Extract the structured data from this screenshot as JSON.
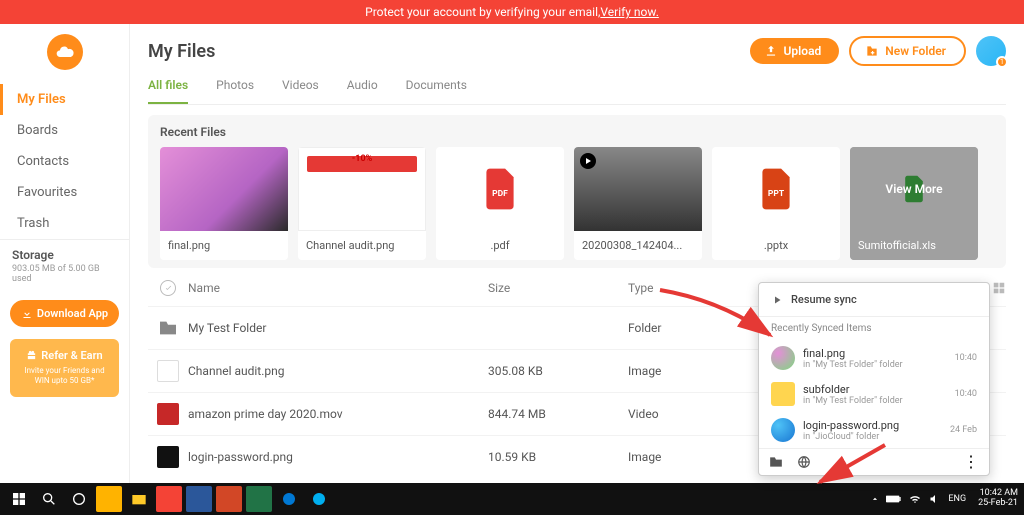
{
  "banner": {
    "text": "Protect your account by verifying your email, ",
    "link": "Verify now."
  },
  "header": {
    "title": "My Files",
    "upload": "Upload",
    "new_folder": "New Folder",
    "avatar_badge": "1"
  },
  "sidebar": {
    "items": [
      {
        "label": "My Files",
        "active": true
      },
      {
        "label": "Boards"
      },
      {
        "label": "Contacts"
      },
      {
        "label": "Favourites"
      },
      {
        "label": "Trash"
      }
    ],
    "storage_title": "Storage",
    "storage_used": "903.05 MB of 5.00 GB used",
    "download_label": "Download App",
    "refer_title": "Refer & Earn",
    "refer_sub": "Invite your Friends and WIN upto 50 GB*"
  },
  "tabs": [
    {
      "label": "All files",
      "active": true
    },
    {
      "label": "Photos"
    },
    {
      "label": "Videos"
    },
    {
      "label": "Audio"
    },
    {
      "label": "Documents"
    }
  ],
  "recent": {
    "title": "Recent Files",
    "items": [
      {
        "name": "final.png"
      },
      {
        "name": "Channel audit.png",
        "badge": "-10%"
      },
      {
        "name": ".pdf",
        "icon": "PDF",
        "color": "#e53935"
      },
      {
        "name": "20200308_142404...",
        "video": true
      },
      {
        "name": ".pptx",
        "icon": "PPT",
        "color": "#d84315"
      },
      {
        "name": "Sumitofficial.xls",
        "more": true,
        "overlay": "View More",
        "color": "#2e7d32"
      }
    ]
  },
  "table": {
    "cols": {
      "name": "Name",
      "size": "Size",
      "type": "Type"
    },
    "rows": [
      {
        "icon": "folder",
        "name": "My Test Folder",
        "size": "",
        "type": "Folder"
      },
      {
        "icon": "doc",
        "name": "Channel audit.png",
        "size": "305.08 KB",
        "type": "Image"
      },
      {
        "icon": "red",
        "name": "amazon prime day 2020.mov",
        "size": "844.74 MB",
        "type": "Video"
      },
      {
        "icon": "black",
        "name": "login-password.png",
        "size": "10.59 KB",
        "type": "Image"
      }
    ]
  },
  "sync": {
    "resume": "Resume sync",
    "subtitle": "Recently Synced Items",
    "items": [
      {
        "name": "final.png",
        "loc": "in \"My Test Folder\" folder",
        "time": "10:40",
        "thumb": "img1"
      },
      {
        "name": "subfolder",
        "loc": "in \"My Test Folder\" folder",
        "time": "10:40",
        "thumb": "folder"
      },
      {
        "name": "login-password.png",
        "loc": "in \"JioCloud\" folder",
        "time": "24 Feb",
        "thumb": "img2"
      }
    ]
  },
  "taskbar": {
    "lang": "ENG",
    "time": "10:42 AM",
    "date": "25-Feb-21"
  }
}
